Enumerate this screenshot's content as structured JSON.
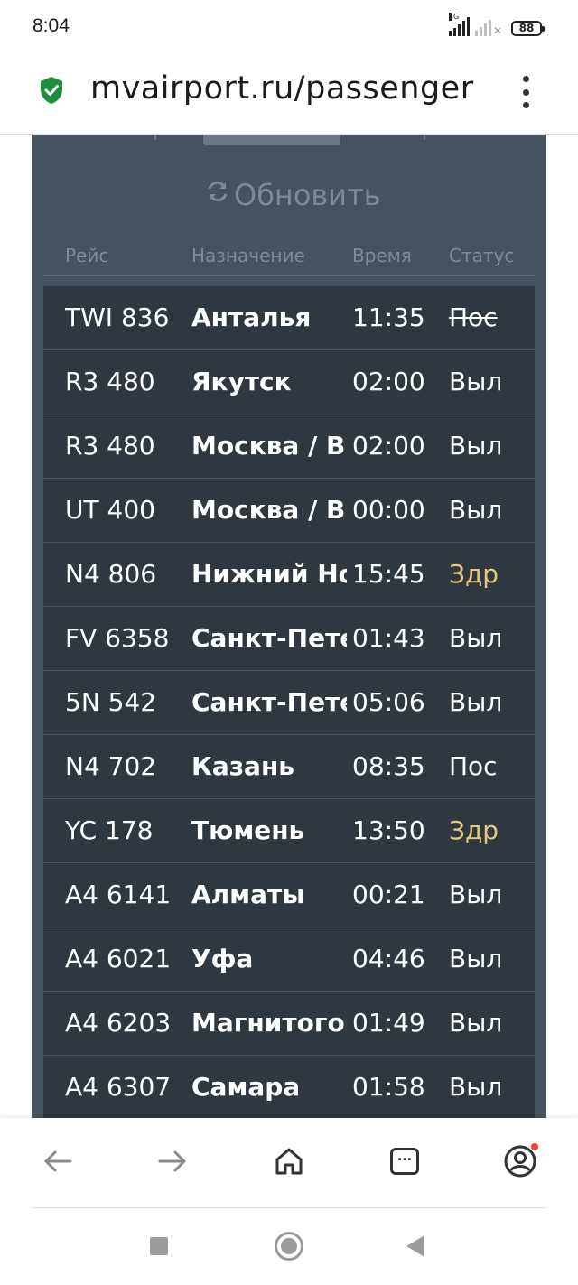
{
  "status_bar": {
    "time": "8:04",
    "network_label": "4G",
    "battery": "88"
  },
  "browser": {
    "url": "mvairport.ru/passenger",
    "secure_icon": "shield-check-icon",
    "menu_icon": "more-vert-icon"
  },
  "board": {
    "refresh_label": "Обновить",
    "columns": {
      "flight": "Рейс",
      "destination": "Назначение",
      "time": "Время",
      "status": "Статус"
    },
    "rows": [
      {
        "flight": "TWI 836",
        "destination": "Анталья",
        "time": "11:35",
        "status": "Пос"
      },
      {
        "flight": "R3 480",
        "destination": "Якутск",
        "time": "02:00",
        "status": "Выл"
      },
      {
        "flight": "R3 480",
        "destination": "Москва / Вн",
        "time": "02:00",
        "status": "Выл"
      },
      {
        "flight": "UT 400",
        "destination": "Москва / Вн",
        "time": "00:00",
        "status": "Выл"
      },
      {
        "flight": "N4 806",
        "destination": "Нижний Но",
        "time": "15:45",
        "status": "Здр"
      },
      {
        "flight": "FV 6358",
        "destination": "Санкт-Пете",
        "time": "01:43",
        "status": "Выл"
      },
      {
        "flight": "5N 542",
        "destination": "Санкт-Пете",
        "time": "05:06",
        "status": "Выл"
      },
      {
        "flight": "N4 702",
        "destination": "Казань",
        "time": "08:35",
        "status": "Пос"
      },
      {
        "flight": "YC 178",
        "destination": "Тюмень",
        "time": "13:50",
        "status": "Здр"
      },
      {
        "flight": "A4 6141",
        "destination": "Алматы",
        "time": "00:21",
        "status": "Выл"
      },
      {
        "flight": "A4 6021",
        "destination": "Уфа",
        "time": "04:46",
        "status": "Выл"
      },
      {
        "flight": "A4 6203",
        "destination": "Магнитогор",
        "time": "01:49",
        "status": "Выл"
      },
      {
        "flight": "A4 6307",
        "destination": "Самара",
        "time": "01:58",
        "status": "Выл"
      }
    ]
  },
  "bottom_nav": {
    "tabs_count": "..."
  },
  "colors": {
    "board_bg": "#46525f",
    "row_bg": "#2f3740",
    "delayed_status": "#e5c97c",
    "secure_green": "#1e8e3e"
  }
}
